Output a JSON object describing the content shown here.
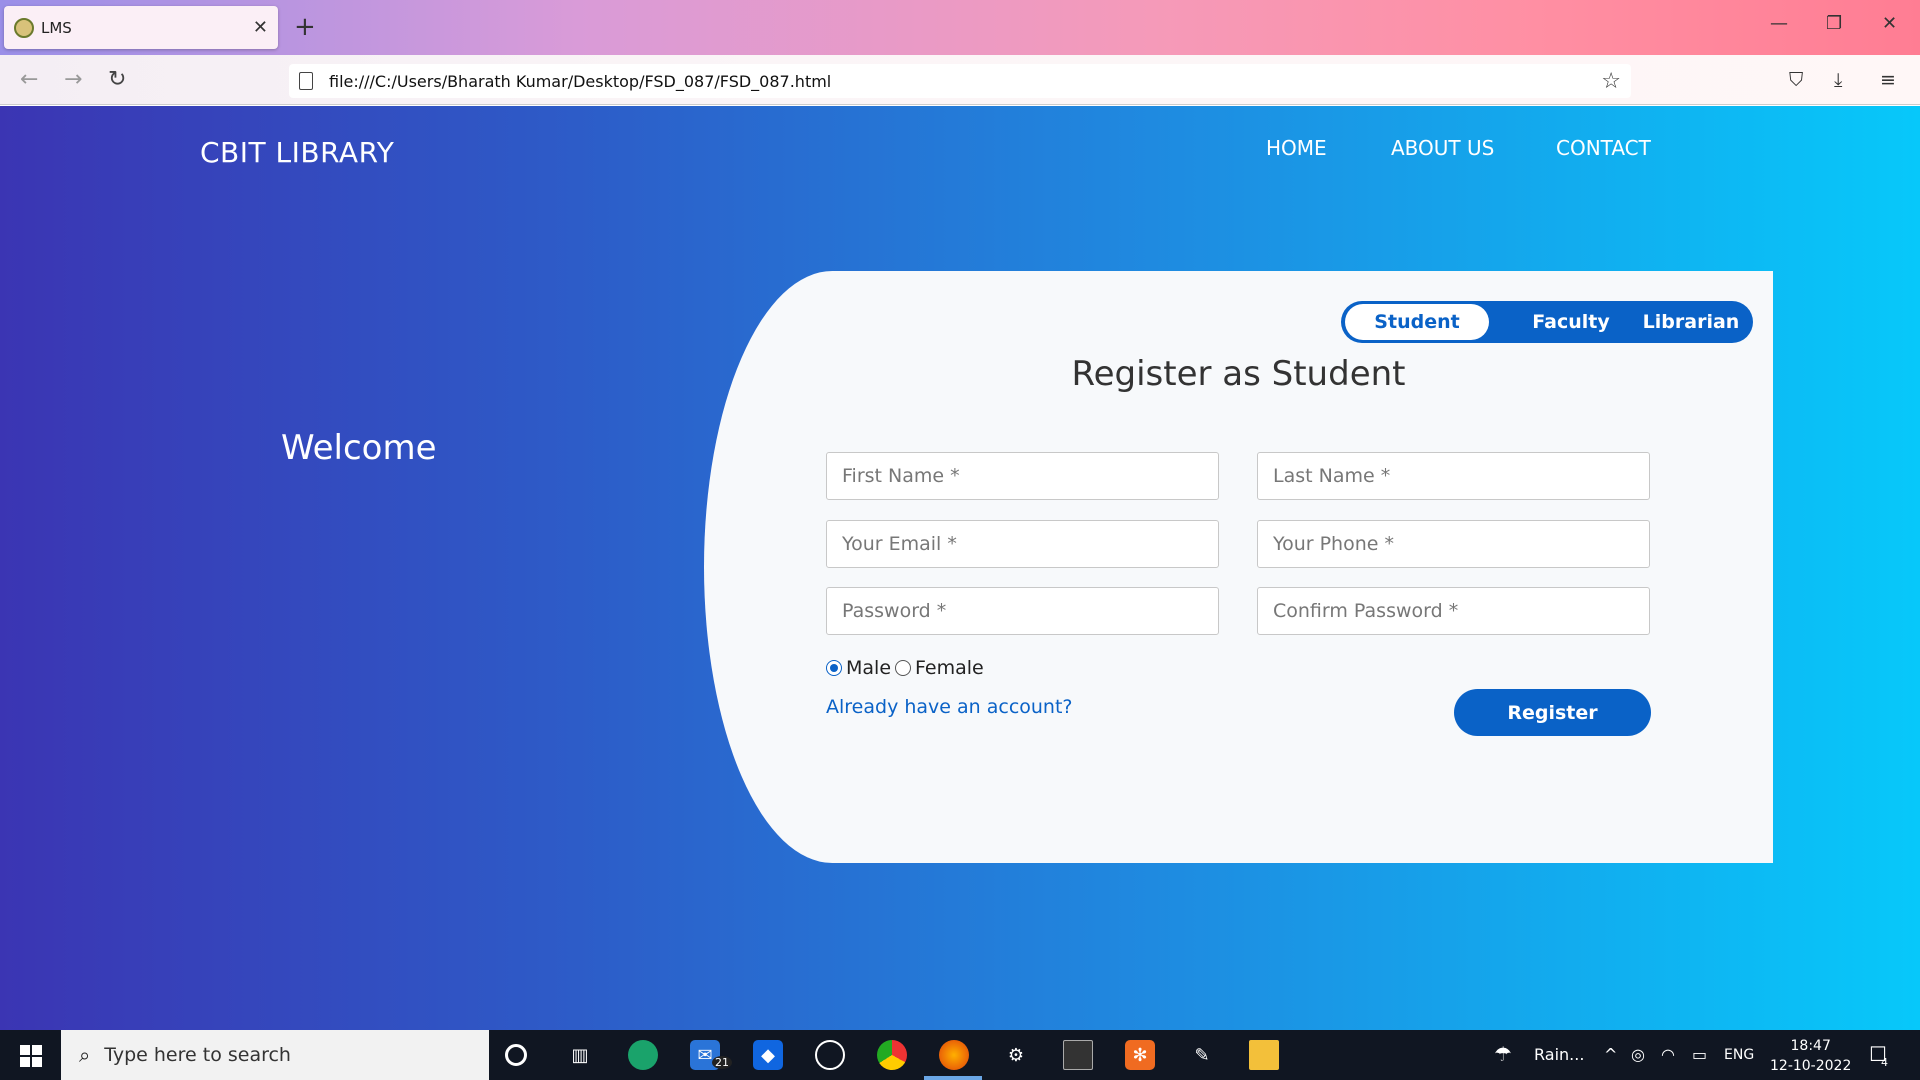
{
  "browser": {
    "tab_title": "LMS",
    "tab_close": "✕",
    "new_tab": "+",
    "url": "file:///C:/Users/Bharath Kumar/Desktop/FSD_087/FSD_087.html",
    "back": "←",
    "forward": "→",
    "reload": "↻",
    "star": "☆",
    "minimize": "—",
    "restore": "❐",
    "close": "✕",
    "pocket": "⛉",
    "download": "⤓",
    "menu": "≡"
  },
  "site": {
    "brand": "CBIT LIBRARY",
    "nav": [
      "HOME",
      "ABOUT US",
      "CONTACT"
    ],
    "welcome": "Welcome"
  },
  "form": {
    "roles": [
      "Student",
      "Faculty",
      "Librarian"
    ],
    "active_role": "Student",
    "title": "Register as Student",
    "placeholders": {
      "first_name": "First Name *",
      "last_name": "Last Name *",
      "email": "Your Email *",
      "phone": "Your Phone *",
      "password": "Password *",
      "confirm_password": "Confirm Password *"
    },
    "gender_options": [
      "Male",
      "Female"
    ],
    "gender_selected": "Male",
    "login_link": "Already have an account?",
    "submit": "Register",
    "accent_color": "#0a62c7"
  },
  "taskbar": {
    "search_placeholder": "Type here to search",
    "mail_badge": "21",
    "weather": "Rain...",
    "lang": "ENG",
    "time": "18:47",
    "date": "12-10-2022",
    "notif_badge": "4",
    "app_icons": [
      "cortana-icon",
      "task-view-icon",
      "edge-icon",
      "mail-icon",
      "dropbox-icon",
      "github-icon",
      "chrome-icon",
      "firefox-icon",
      "settings-icon",
      "terminal-icon",
      "xampp-icon",
      "pen-icon",
      "file-explorer-icon"
    ]
  }
}
